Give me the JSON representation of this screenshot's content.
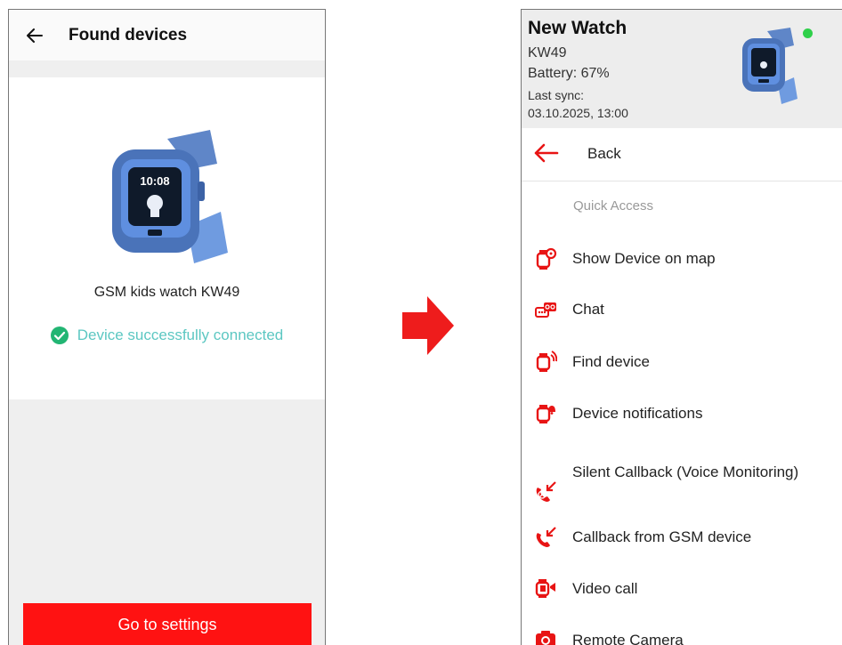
{
  "left_screen": {
    "title": "Found devices",
    "device_name": "GSM kids watch KW49",
    "status": "Device successfully connected",
    "button_label": "Go to settings",
    "watch_time": "10:08",
    "status_color": "#5cc7c2",
    "button_color": "#ff1212"
  },
  "right_screen": {
    "device_title": "New Watch",
    "model": "KW49",
    "battery": "Battery: 67%",
    "last_sync_label": "Last sync:",
    "last_sync_value": "03.10.2025, 13:00",
    "back_label": "Back",
    "section_label": "Quick Access",
    "online_color": "#2fd04a",
    "accent_color": "#e81414",
    "menu": [
      {
        "label": "Show Device on map",
        "icon": "watch-location-icon"
      },
      {
        "label": "Chat",
        "icon": "chat-icon"
      },
      {
        "label": "Find device",
        "icon": "watch-ring-icon"
      },
      {
        "label": "Device notifications",
        "icon": "watch-bell-icon"
      },
      {
        "label": "Silent Callback (Voice Monitoring)",
        "icon": "silent-callback-icon"
      },
      {
        "label": "Callback from GSM device",
        "icon": "callback-phone-icon"
      },
      {
        "label": "Video call",
        "icon": "video-call-icon"
      },
      {
        "label": "Remote Camera",
        "icon": "camera-icon"
      }
    ]
  }
}
